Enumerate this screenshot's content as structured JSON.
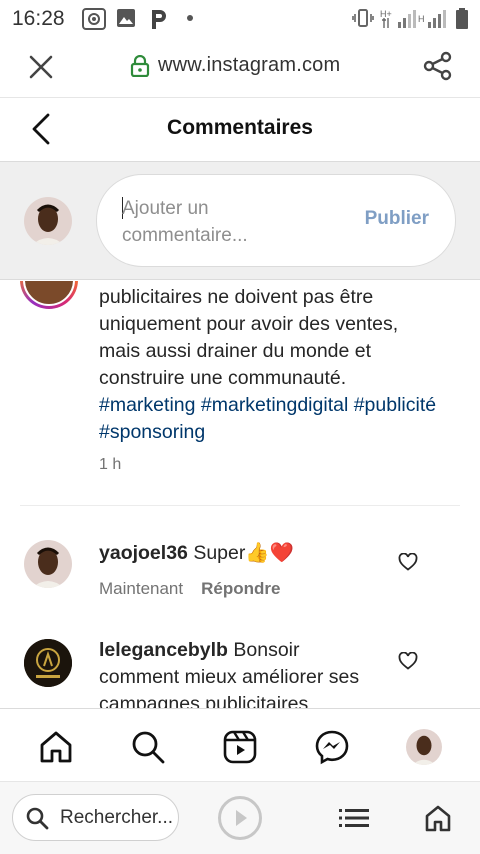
{
  "status_bar": {
    "time": "16:28",
    "icons": [
      "screenshot-icon",
      "image-icon",
      "p-app-icon",
      "dot-icon",
      "vibrate-icon",
      "signal-h-plus-icon",
      "signal-h-icon",
      "battery-icon"
    ]
  },
  "browser": {
    "domain": "www.instagram.com",
    "icons": [
      "close-icon",
      "lock-icon",
      "share-icon"
    ]
  },
  "header": {
    "title": "Commentaires"
  },
  "composer": {
    "placeholder": "Ajouter un commentaire...",
    "post_label": "Publier"
  },
  "post": {
    "text": "publicitaires ne doivent pas être uniquement pour avoir des ventes, mais aussi drainer du monde et construire une communauté.",
    "hashtags": "#marketing #marketingdigital #publicité #sponsoring",
    "time": "1 h"
  },
  "comments": [
    {
      "username": "yaojoel36",
      "text": "Super👍❤️",
      "time": "Maintenant",
      "reply_label": "Répondre"
    },
    {
      "username": "lelegancebylb",
      "text": "Bonsoir comment mieux améliorer ses campagnes publicitaires"
    }
  ],
  "bottom_nav": {
    "icons": [
      "home-icon",
      "search-icon",
      "reels-icon",
      "messenger-icon",
      "profile-avatar"
    ]
  },
  "browser_bottom": {
    "search_label": "Rechercher...",
    "icons": [
      "search-icon",
      "play-icon",
      "tabs-list-icon",
      "home-icon"
    ]
  },
  "colors": {
    "link": "#00376b",
    "post_button_disabled": "#7f9ec4",
    "secondary_text": "#737373",
    "composer_bg": "#efefef"
  }
}
